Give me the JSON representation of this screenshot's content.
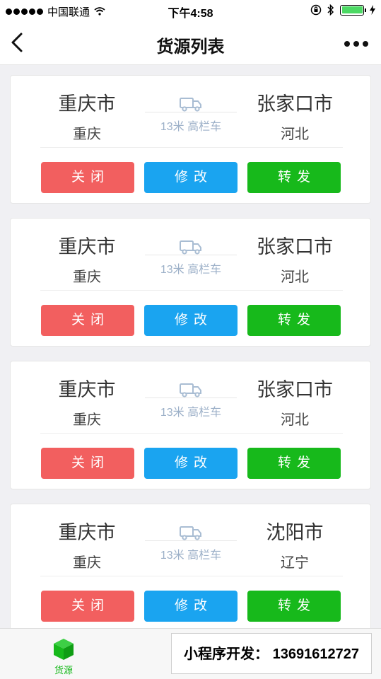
{
  "status_bar": {
    "carrier": "中国联通",
    "time": "下午4:58"
  },
  "nav": {
    "title": "货源列表"
  },
  "listings": [
    {
      "from_city": "重庆市",
      "from_province": "重庆",
      "to_city": "张家口市",
      "to_province": "河北",
      "vehicle": "13米 高栏车"
    },
    {
      "from_city": "重庆市",
      "from_province": "重庆",
      "to_city": "张家口市",
      "to_province": "河北",
      "vehicle": "13米 高栏车"
    },
    {
      "from_city": "重庆市",
      "from_province": "重庆",
      "to_city": "张家口市",
      "to_province": "河北",
      "vehicle": "13米 高栏车"
    },
    {
      "from_city": "重庆市",
      "from_province": "重庆",
      "to_city": "沈阳市",
      "to_province": "辽宁",
      "vehicle": "13米 高栏车"
    }
  ],
  "actions": {
    "close_label": "关闭",
    "edit_label": "修改",
    "forward_label": "转发"
  },
  "tab_bar": {
    "tabs": [
      {
        "label": "货源",
        "icon": "cube-icon",
        "active": true
      },
      {
        "label": "",
        "icon": "truck-icon",
        "active": false
      },
      {
        "label": "",
        "icon": "user-icon",
        "active": false
      }
    ]
  },
  "promo": {
    "text": "小程序开发：  13691612727"
  },
  "colors": {
    "close": "#f25f5f",
    "edit": "#1aa4f0",
    "forward": "#17b91b",
    "active_tab": "#17b91b"
  }
}
